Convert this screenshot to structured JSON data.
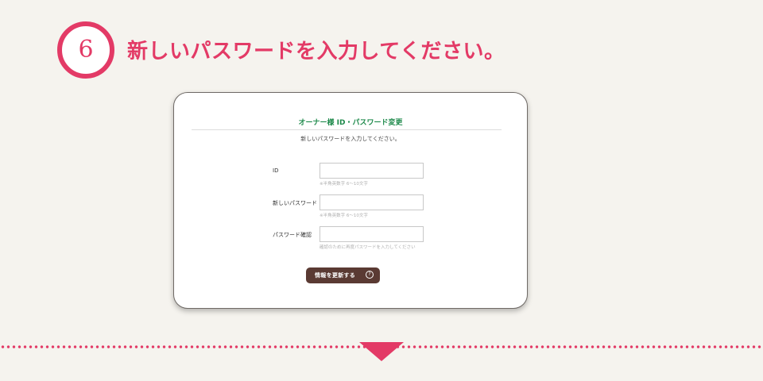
{
  "step": {
    "number": "6",
    "title": "新しいパスワードを入力してください。"
  },
  "card": {
    "title": "オーナー様 ID・パスワード変更",
    "instruction": "新しいパスワードを入力してください。",
    "fields": [
      {
        "label": "ID",
        "value": "",
        "hint": "※半角英数字 6〜10文字"
      },
      {
        "label": "新しいパスワード",
        "value": "",
        "hint": "※半角英数字 6〜10文字"
      },
      {
        "label": "パスワード確認",
        "value": "",
        "hint": "確認のために再度パスワードを入力してください"
      }
    ],
    "submit": {
      "label": "情報を更新する",
      "icon": "question-circle-icon",
      "icon_glyph": "?"
    }
  },
  "colors": {
    "accent": "#e33a66",
    "title_green": "#1f8a4c",
    "button_brown": "#5a3a33",
    "background": "#f5f3ee"
  }
}
